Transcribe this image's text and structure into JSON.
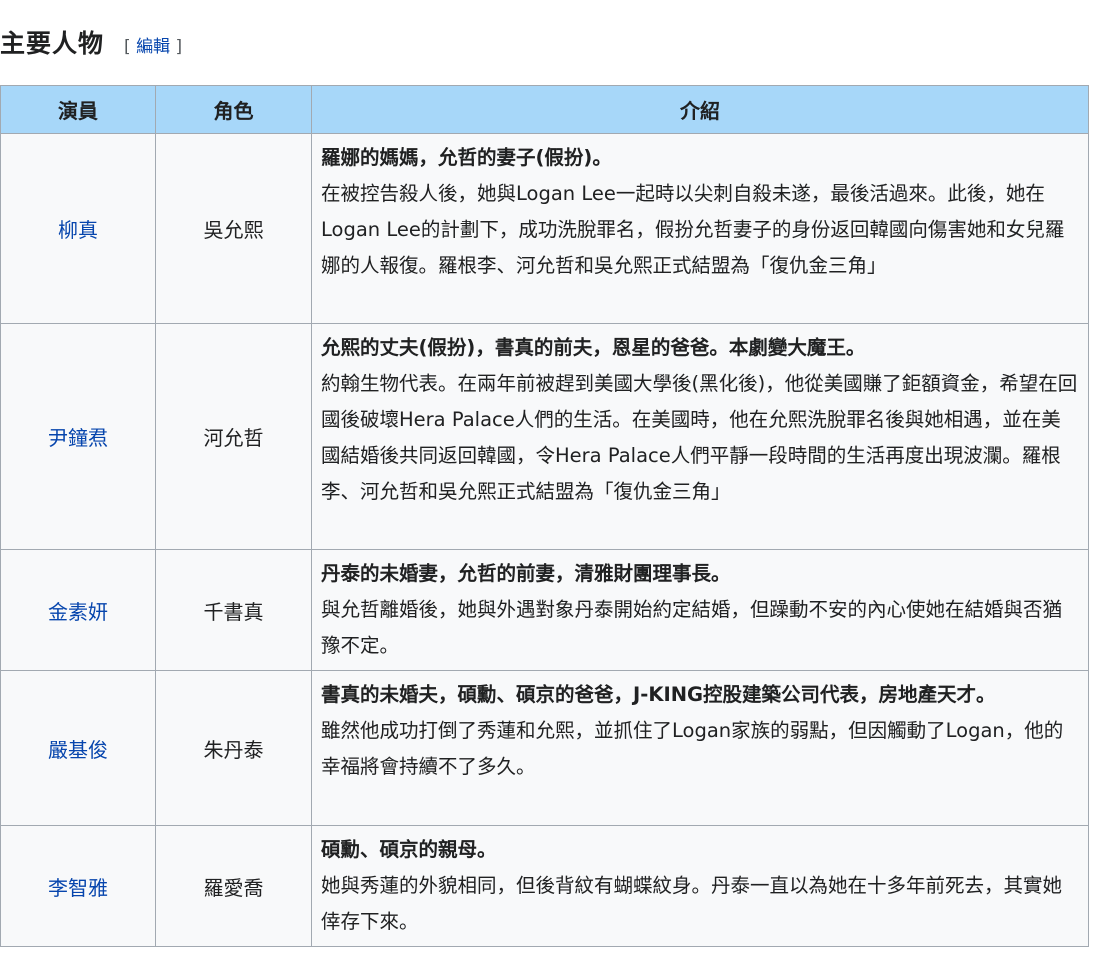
{
  "section": {
    "title": "主要人物",
    "edit_open": "[",
    "edit_label": "編輯",
    "edit_close": "]"
  },
  "table": {
    "headers": [
      "演員",
      "角色",
      "介紹"
    ],
    "rows": [
      {
        "actor": "柳真",
        "role": "吳允熙",
        "summary": "羅娜的媽媽，允哲的妻子(假扮)。",
        "body": "在被控告殺人後，她與Logan Lee一起時以尖刺自殺未遂，最後活過來。此後，她在Logan Lee的計劃下，成功洗脫罪名，假扮允哲妻子的身份返回韓國向傷害她和女兒羅娜的人報復。羅根李、河允哲和吳允熙正式結盟為「復仇金三角」"
      },
      {
        "actor": "尹鐘焄",
        "role": "河允哲",
        "summary": "允熙的丈夫(假扮)，書真的前夫，恩星的爸爸。本劇變大魔王。",
        "body": "約翰生物代表。在兩年前被趕到美國大學後(黑化後)，他從美國賺了鉅額資金，希望在回國後破壞Hera Palace人們的生活。在美國時，他在允熙洗脫罪名後與她相遇，並在美國結婚後共同返回韓國，令Hera Palace人們平靜一段時間的生活再度出現波瀾。羅根李、河允哲和吳允熙正式結盟為「復仇金三角」"
      },
      {
        "actor": "金素妍",
        "role": "千書真",
        "summary": "丹泰的未婚妻，允哲的前妻，清雅財團理事長。",
        "body": "與允哲離婚後，她與外遇對象丹泰開始約定結婚，但躁動不安的內心使她在結婚與否猶豫不定。"
      },
      {
        "actor": "嚴基俊",
        "role": "朱丹泰",
        "summary": "書真的未婚夫，碩勳、碩京的爸爸，J-KING控股建築公司代表，房地產天才。",
        "body": "雖然他成功打倒了秀蓮和允熙，並抓住了Logan家族的弱點，但因觸動了Logan，他的幸福將會持續不了多久。"
      },
      {
        "actor": "李智雅",
        "role": "羅愛喬",
        "summary": "碩勳、碩京的親母。",
        "body": "她與秀蓮的外貌相同，但後背紋有蝴蝶紋身。丹泰一直以為她在十多年前死去，其實她倖存下來。"
      }
    ]
  }
}
